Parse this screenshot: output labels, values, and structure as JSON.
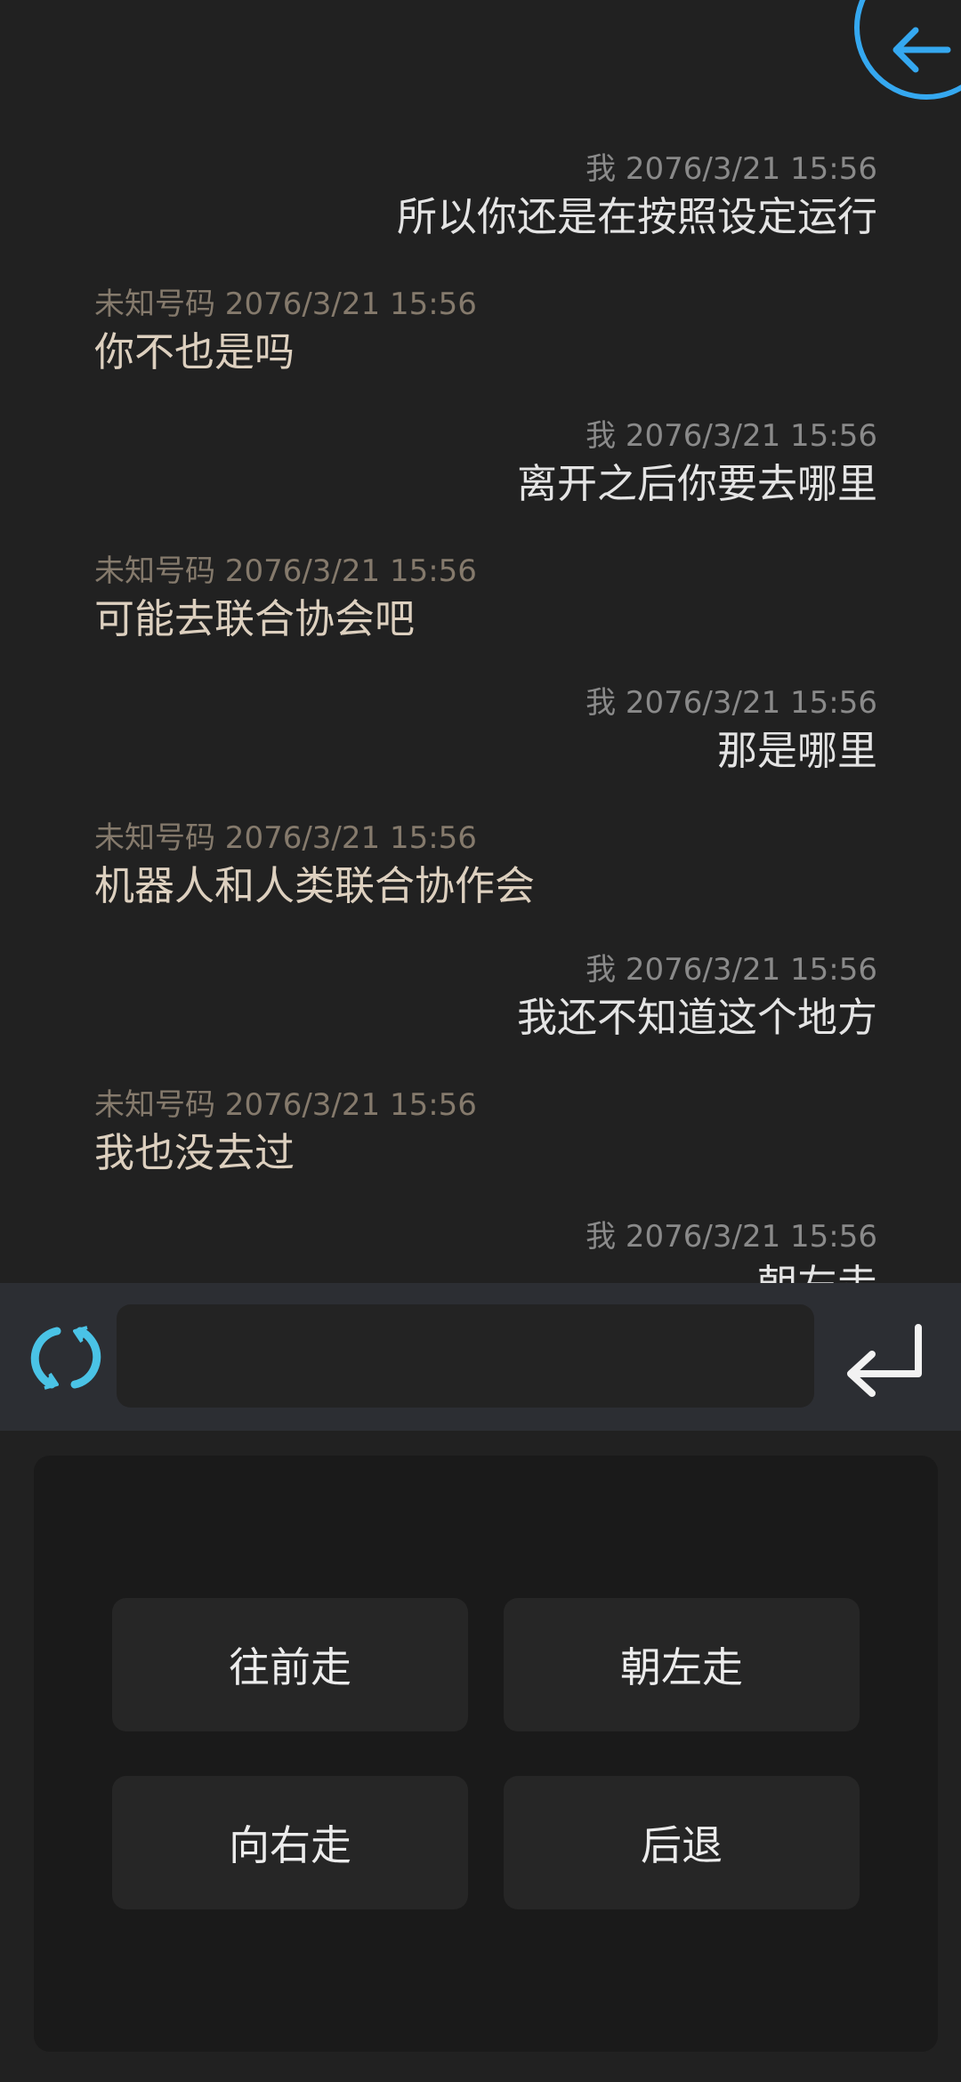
{
  "header": {
    "back_icon": "arrow-left-icon"
  },
  "colors": {
    "background": "#212121",
    "accent_blue": "#35a8f0",
    "refresh_cyan": "#4ac3e6",
    "input_bar": "#2c2e33",
    "panel": "#1a1a1a",
    "option_button": "#262626",
    "my_meta": "#8a8a8a",
    "other_meta": "#857a6c",
    "other_text": "#ddd0bf"
  },
  "messages": [
    {
      "sender": "我",
      "time": "2076/3/21 15:56",
      "meta": "我 2076/3/21 15:56",
      "text": "所以你还是在按照设定运行"
    },
    {
      "sender": "未知号码",
      "time": "2076/3/21 15:56",
      "meta": "未知号码 2076/3/21 15:56",
      "text": "你不也是吗"
    },
    {
      "sender": "我",
      "time": "2076/3/21 15:56",
      "meta": "我 2076/3/21 15:56",
      "text": "离开之后你要去哪里"
    },
    {
      "sender": "未知号码",
      "time": "2076/3/21 15:56",
      "meta": "未知号码 2076/3/21 15:56",
      "text": "可能去联合协会吧"
    },
    {
      "sender": "我",
      "time": "2076/3/21 15:56",
      "meta": "我 2076/3/21 15:56",
      "text": "那是哪里"
    },
    {
      "sender": "未知号码",
      "time": "2076/3/21 15:56",
      "meta": "未知号码 2076/3/21 15:56",
      "text": "机器人和人类联合协作会"
    },
    {
      "sender": "我",
      "time": "2076/3/21 15:56",
      "meta": "我 2076/3/21 15:56",
      "text": "我还不知道这个地方"
    },
    {
      "sender": "未知号码",
      "time": "2076/3/21 15:56",
      "meta": "未知号码 2076/3/21 15:56",
      "text": "我也没去过"
    },
    {
      "sender": "我",
      "time": "2076/3/21 15:56",
      "meta": "我 2076/3/21 15:56",
      "text": "朝左走"
    }
  ],
  "input_bar": {
    "refresh_icon": "refresh-icon",
    "input_value": "",
    "input_placeholder": "",
    "send_icon": "enter-return-icon"
  },
  "options": [
    {
      "label": "往前走"
    },
    {
      "label": "朝左走"
    },
    {
      "label": "向右走"
    },
    {
      "label": "后退"
    }
  ]
}
